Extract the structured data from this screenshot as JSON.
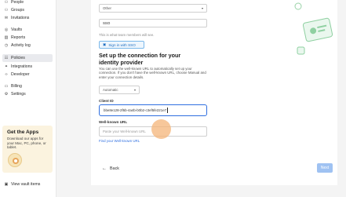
{
  "sidebar": {
    "items": [
      {
        "label": "People",
        "icon": "people-icon"
      },
      {
        "label": "Groups",
        "icon": "groups-icon"
      },
      {
        "label": "Invitations",
        "icon": "invitations-icon"
      },
      {
        "label": "Vaults",
        "icon": "vaults-icon"
      },
      {
        "label": "Reports",
        "icon": "reports-icon"
      },
      {
        "label": "Activity log",
        "icon": "activity-log-icon"
      },
      {
        "label": "Policies",
        "icon": "policies-icon"
      },
      {
        "label": "Integrations",
        "icon": "integrations-icon"
      },
      {
        "label": "Developer",
        "icon": "developer-icon"
      },
      {
        "label": "Billing",
        "icon": "billing-icon"
      },
      {
        "label": "Settings",
        "icon": "settings-icon"
      }
    ],
    "apps_card": {
      "title": "Get the Apps",
      "description": "Download our apps for your Mac, PC, phone, or tablet."
    },
    "view_vault_items": "View vault items"
  },
  "form": {
    "provider_select": "Other",
    "provider_name_value": "SSO",
    "button_hint": "This is what team members will see.",
    "sso_button_label": "Sign in with SSO",
    "connection_title": "Set up the connection for your identity provider",
    "connection_desc": "You can use the well-known URL to automatically set up your connection. If you don't have the well-known URL, choose Manual and enter your connection details.",
    "method_select": "Automatic",
    "client_id_label": "Client ID",
    "client_id_value": "bbe8e128-2f6b-4a4b-b0b2-c3ef5fe221e7",
    "wellknown_label": "Well-known URL",
    "wellknown_placeholder": "Paste your Well-known URL",
    "wellknown_link": "Find your Well-known URL",
    "back_label": "Back",
    "next_label": "Next"
  },
  "colors": {
    "accent": "#2f6fe0",
    "next_disabled": "#9fc2f2",
    "apps_card_bg": "#fbf3df"
  }
}
